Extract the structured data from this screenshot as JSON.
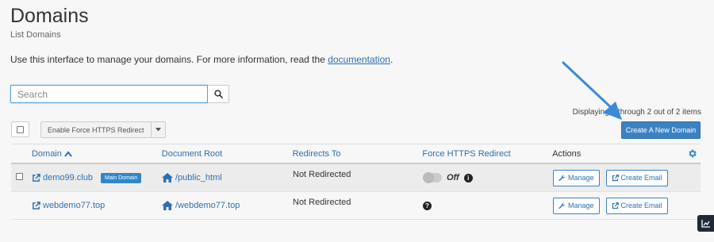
{
  "header": {
    "title": "Domains",
    "subtitle": "List Domains"
  },
  "intro": {
    "text": "Use this interface to manage your domains. For more information, read the ",
    "link": "documentation",
    "suffix": "."
  },
  "search": {
    "placeholder": "Search",
    "value": ""
  },
  "display_count": "Displaying 1 through 2 out of 2 items",
  "bulk": {
    "action_label": "Enable Force HTTPS Redirect"
  },
  "create_button": "Create A New Domain",
  "arrow_color": "#3b8ad8",
  "table": {
    "headers": {
      "domain": "Domain",
      "doc_root": "Document Root",
      "redirects": "Redirects To",
      "https": "Force HTTPS Redirect",
      "actions": "Actions"
    },
    "rows": [
      {
        "domain": "demo99.club",
        "badge": "Main Domain",
        "doc_root": "/public_html",
        "redirect": "Not Redirected",
        "https_state": "Off",
        "manage": "Manage",
        "create_email": "Create Email"
      },
      {
        "domain": "webdemo77.top",
        "doc_root": "/webdemo77.top",
        "redirect": "Not Redirected",
        "manage": "Manage",
        "create_email": "Create Email"
      }
    ]
  },
  "colors": {
    "accent": "#3b82c4",
    "link": "#2f6fb0",
    "badge": "#2f86c8"
  }
}
